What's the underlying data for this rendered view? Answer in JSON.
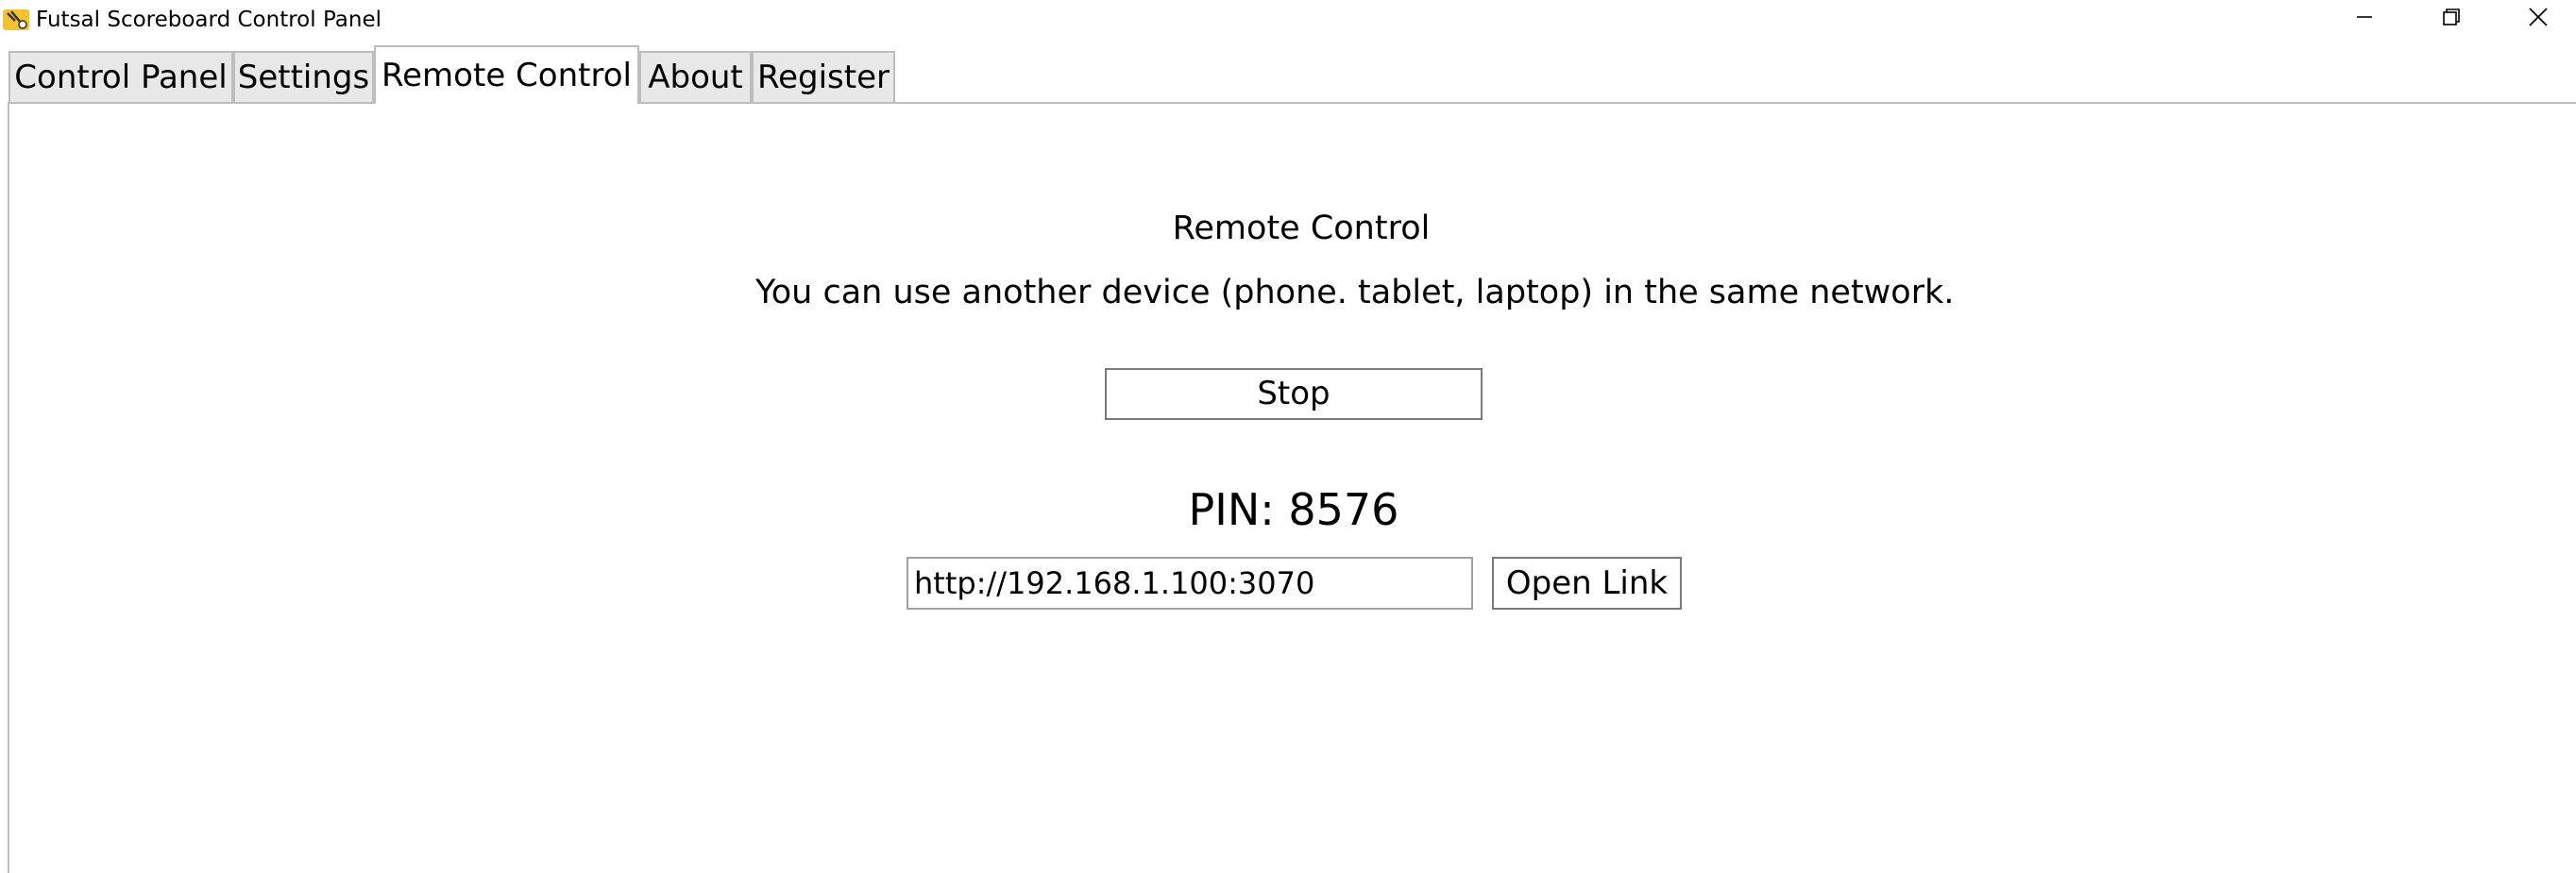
{
  "window": {
    "title": "Futsal Scoreboard Control Panel"
  },
  "tabs": [
    {
      "label": "Control Panel",
      "active": false
    },
    {
      "label": "Settings",
      "active": false
    },
    {
      "label": "Remote Control",
      "active": true
    },
    {
      "label": "About",
      "active": false
    },
    {
      "label": "Register",
      "active": false
    }
  ],
  "remote": {
    "heading": "Remote Control",
    "subtitle": "You can use another device (phone. tablet, laptop) in the same network.",
    "stop_label": "Stop",
    "pin_label": "PIN: 8576",
    "url_value": "http://192.168.1.100:3070",
    "open_link_label": "Open Link"
  },
  "icons": {
    "app": "futsal-app-icon",
    "minimize": "minimize-icon",
    "maximize": "restore-icon",
    "close": "close-icon"
  },
  "colors": {
    "tab_inactive_bg": "#e8e8e8",
    "tab_active_bg": "#ffffff",
    "border": "#bdbdbd",
    "app_icon_yellow": "#f2c230"
  }
}
